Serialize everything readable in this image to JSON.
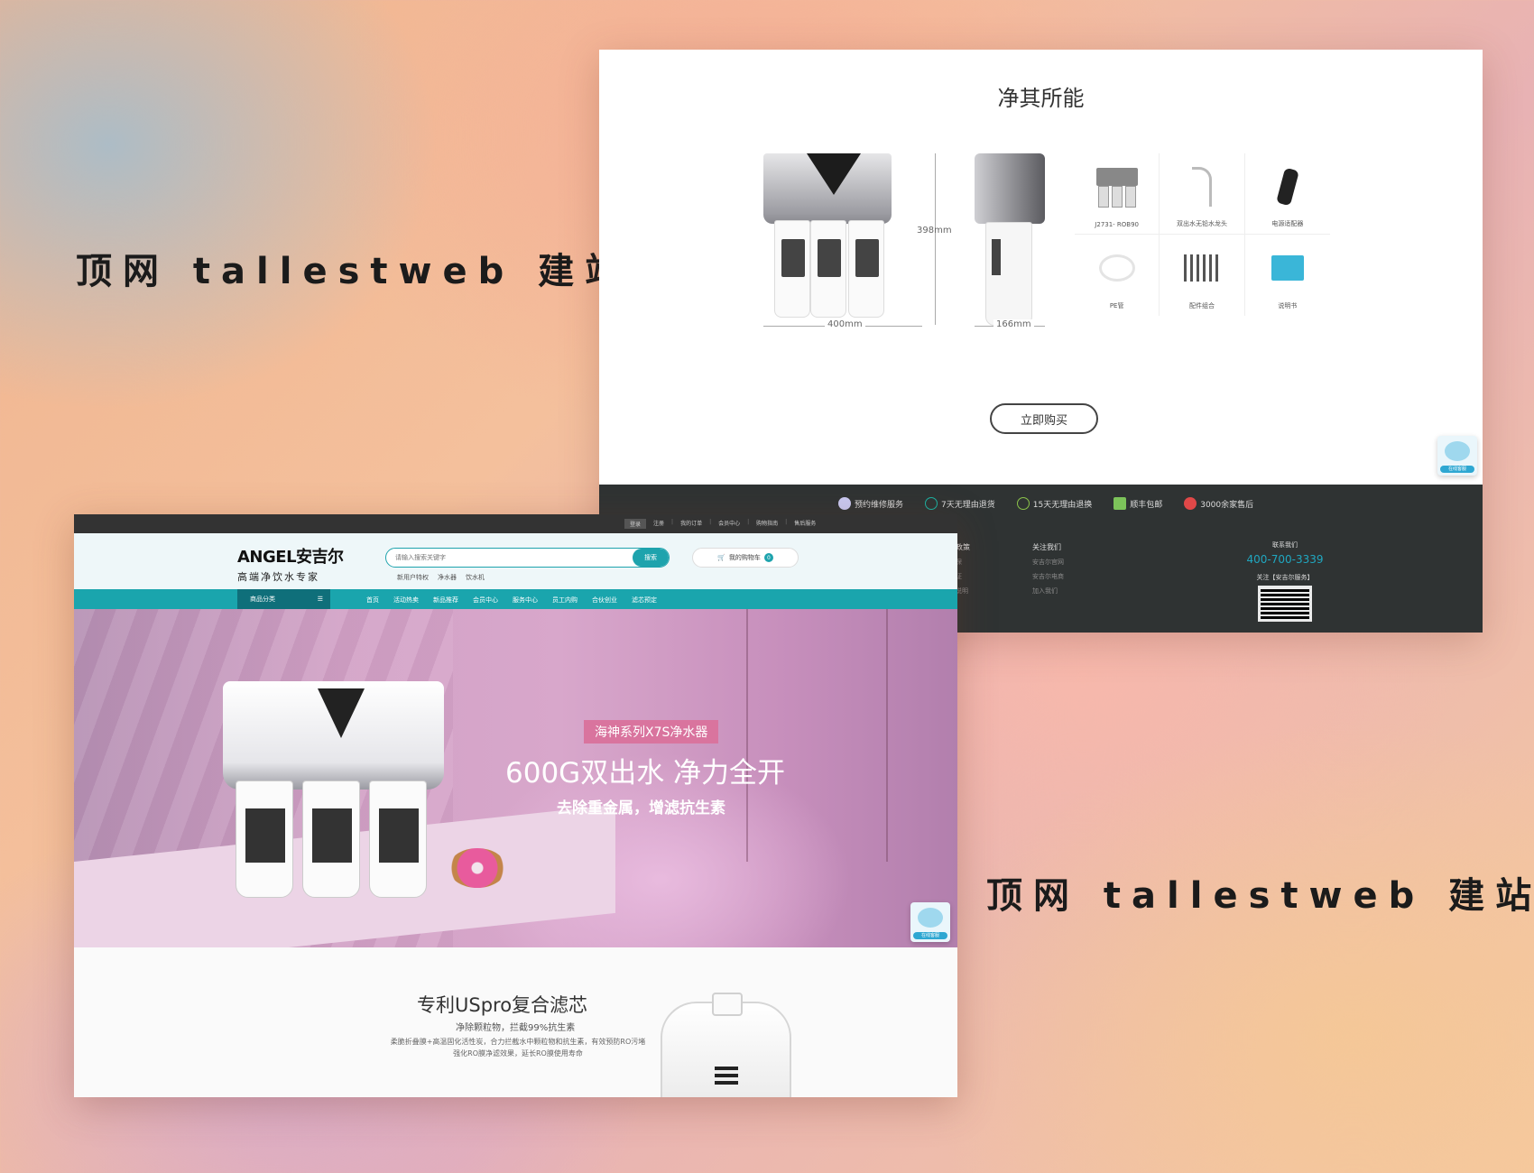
{
  "taglines": [
    "顶网 tallestweb 建站",
    "顶网 tallestweb 建站"
  ],
  "detail_page": {
    "section_title": "净其所能",
    "dimensions": {
      "height": "398mm",
      "width": "400mm",
      "depth": "166mm"
    },
    "accessories": [
      "J2731- ROB90",
      "双出水无铅水龙头",
      "电源适配器",
      "PE管",
      "配件组合",
      "说明书"
    ],
    "buy_button": "立即购买",
    "services": [
      "预约维修服务",
      "7天无理由退货",
      "15天无理由退换",
      "顺丰包邮",
      "3000余家售后"
    ],
    "footer": {
      "col_a_heading": "政策",
      "col_a_items": [
        "保",
        "证",
        "说明"
      ],
      "col_b_heading": "关注我们",
      "col_b_items": [
        "安吉尔官网",
        "安吉尔电商",
        "加入我们"
      ],
      "contact_heading": "联系我们",
      "phone": "400-700-3339",
      "follow_label": "关注【安吉尔服务】"
    }
  },
  "home_page": {
    "topbar_links": [
      "登录",
      "注册",
      "我的订单",
      "会员中心",
      "购物指南",
      "售后服务"
    ],
    "logo": {
      "main": "ANGEL安吉尔",
      "sub": "高端净饮水专家"
    },
    "search": {
      "placeholder": "请输入搜索关键字",
      "button": "搜索"
    },
    "hot_words": [
      "新用户特权",
      "净水器",
      "饮水机"
    ],
    "cart": {
      "label": "我的购物车",
      "count": "0"
    },
    "category_button": "商品分类",
    "nav_items": [
      "首页",
      "活动热卖",
      "新品推荐",
      "会员中心",
      "服务中心",
      "员工内购",
      "合伙创业",
      "滤芯预定"
    ],
    "banner": {
      "tag": "海神系列X7S净水器",
      "headline": "600G双出水 净力全开",
      "subline": "去除重金属，增滤抗生素"
    },
    "feature": {
      "title": "专利USpro复合滤芯",
      "subtitle": "净除颗粒物，拦截99%抗生素",
      "description": "柔脆折叠膜+高温固化活性炭，合力拦截水中颗粒物和抗生素，有效预防RO污堵强化RO膜净滤效果，延长RO膜使用寿命"
    },
    "float_widget_label": "在线客服"
  },
  "colors": {
    "teal": "#1aa5ad",
    "dark_footer": "#2f3333",
    "banner_pink": "#d2a2c6",
    "tag_pink": "#d9749e"
  }
}
